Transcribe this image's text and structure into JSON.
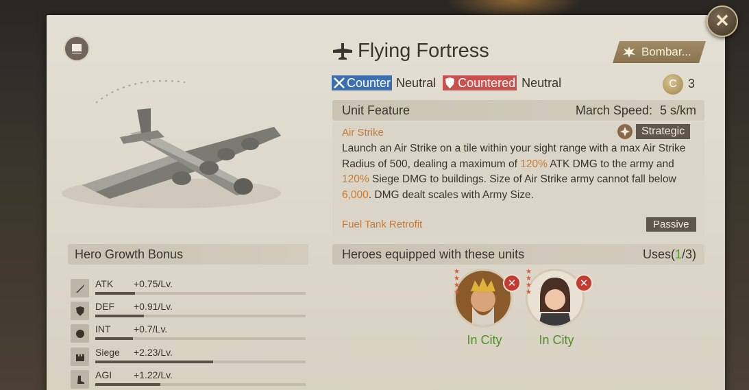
{
  "unit": {
    "name": "Flying Fortress",
    "type_label": "Bombar...",
    "counter_label": "Counter",
    "counter_value": "Neutral",
    "countered_label": "Countered",
    "countered_value": "Neutral",
    "cost_letter": "C",
    "cost_value": "3"
  },
  "features": {
    "header": "Unit Feature",
    "march_speed_label": "March Speed:",
    "march_speed_value": "5 s/km",
    "items": [
      {
        "name": "Air Strike",
        "tag": "Strategic",
        "desc_parts": [
          "Launch an Air Strike on a tile within your sight range with a max Air Strike Radius of 500, dealing a maximum of ",
          "120%",
          " ATK DMG to the army and ",
          "120%",
          " Siege DMG to buildings. Size of Air Strike army cannot fall below ",
          "6,000",
          ". DMG dealt scales with Army Size."
        ]
      },
      {
        "name": "Fuel Tank Retrofit",
        "tag": "Passive"
      }
    ]
  },
  "growth": {
    "header": "Hero Growth Bonus",
    "stats": [
      {
        "name": "ATK",
        "value": "+0.75/Lv.",
        "level": 0.19,
        "icon": "sword-icon"
      },
      {
        "name": "DEF",
        "value": "+0.91/Lv.",
        "level": 0.23,
        "icon": "shield-icon"
      },
      {
        "name": "INT",
        "value": "+0.7/Lv.",
        "level": 0.18,
        "icon": "brain-icon"
      },
      {
        "name": "Siege",
        "value": "+2.23/Lv.",
        "level": 0.56,
        "icon": "castle-icon"
      },
      {
        "name": "AGI",
        "value": "+1.22/Lv.",
        "level": 0.31,
        "icon": "boot-icon"
      }
    ]
  },
  "heroes": {
    "header": "Heroes equipped with these units",
    "uses_prefix": "Uses(",
    "uses_count": "1",
    "uses_suffix": "/3)",
    "list": [
      {
        "status": "In City"
      },
      {
        "status": "In City"
      }
    ]
  },
  "colors": {
    "highlight": "#d07a2a",
    "counter_tag": "#3b6fb0",
    "countered_tag": "#c8514d",
    "status_green": "#4e8f2a"
  }
}
